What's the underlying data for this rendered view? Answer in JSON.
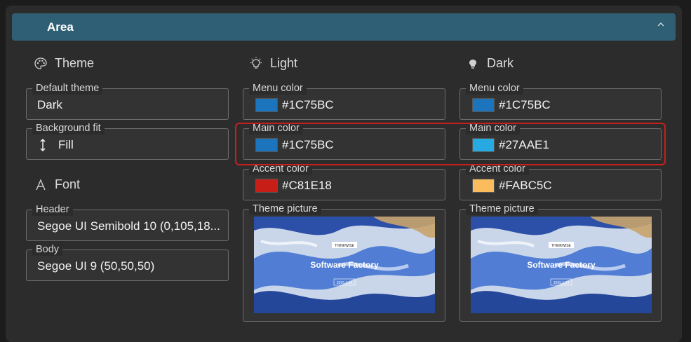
{
  "area": {
    "title": "Area"
  },
  "theme": {
    "title": "Theme",
    "default_theme": {
      "label": "Default theme",
      "value": "Dark"
    },
    "background_fit": {
      "label": "Background fit",
      "value": "Fill"
    }
  },
  "font": {
    "title": "Font",
    "header": {
      "label": "Header",
      "value": "Segoe UI Semibold 10 (0,105,18..."
    },
    "body": {
      "label": "Body",
      "value": "Segoe UI 9 (50,50,50)"
    }
  },
  "light": {
    "title": "Light",
    "menu_color": {
      "label": "Menu color",
      "value": "#1C75BC",
      "swatch": "#1C75BC"
    },
    "main_color": {
      "label": "Main color",
      "value": "#1C75BC",
      "swatch": "#1C75BC"
    },
    "accent_color": {
      "label": "Accent color",
      "value": "#C81E18",
      "swatch": "#C81E18"
    },
    "theme_picture": {
      "label": "Theme picture",
      "logo": "THINKWISE",
      "title": "Software Factory",
      "version": "2025.1.14"
    }
  },
  "dark": {
    "title": "Dark",
    "menu_color": {
      "label": "Menu color",
      "value": "#1C75BC",
      "swatch": "#1C75BC"
    },
    "main_color": {
      "label": "Main color",
      "value": "#27AAE1",
      "swatch": "#27AAE1"
    },
    "accent_color": {
      "label": "Accent color",
      "value": "#FABC5C",
      "swatch": "#FABC5C"
    },
    "theme_picture": {
      "label": "Theme picture",
      "logo": "THINKWISE",
      "title": "Software Factory",
      "version": "2025.1.14"
    }
  },
  "colors": {
    "header_bar": "#2f5f74",
    "panel": "#2c2c2c",
    "highlight": "#c81e1e"
  }
}
